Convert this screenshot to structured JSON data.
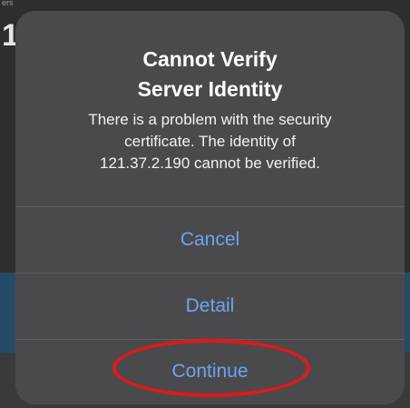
{
  "background": {
    "glyph": "1",
    "tiny_text": "ers"
  },
  "alert": {
    "title_line1": "Cannot Verify",
    "title_line2": "Server Identity",
    "message_line1": "There is a problem with the security",
    "message_line2": "certificate. The identity of",
    "message_line3": "121.37.2.190 cannot be verified.",
    "buttons": [
      {
        "label": "Cancel"
      },
      {
        "label": "Detail"
      },
      {
        "label": "Continue"
      }
    ]
  },
  "colors": {
    "button_text": "#6ea3f2",
    "highlight": "#e0191d",
    "alert_bg": "#4a4a4c"
  }
}
